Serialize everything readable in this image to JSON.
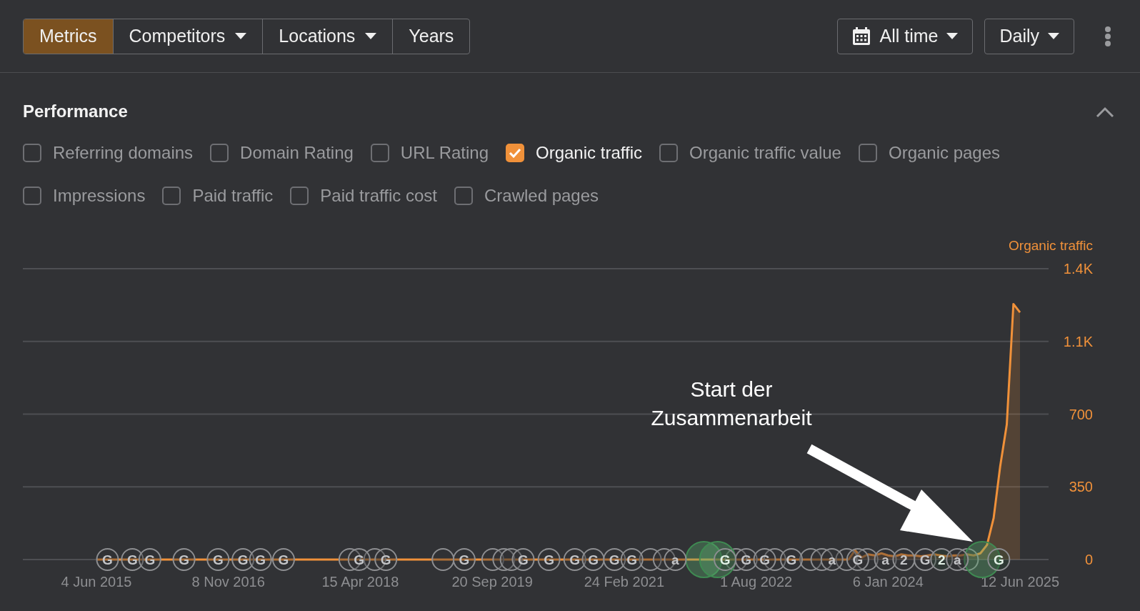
{
  "toolbar": {
    "segments": [
      {
        "label": "Metrics",
        "selected": true,
        "dropdown": false
      },
      {
        "label": "Competitors",
        "selected": false,
        "dropdown": true
      },
      {
        "label": "Locations",
        "selected": false,
        "dropdown": true
      },
      {
        "label": "Years",
        "selected": false,
        "dropdown": false
      }
    ],
    "date_range": {
      "label": "All time"
    },
    "interval": {
      "label": "Daily"
    }
  },
  "performance": {
    "title": "Performance",
    "expanded": true,
    "metrics": [
      {
        "label": "Referring domains",
        "checked": false
      },
      {
        "label": "Domain Rating",
        "checked": false
      },
      {
        "label": "URL Rating",
        "checked": false
      },
      {
        "label": "Organic traffic",
        "checked": true
      },
      {
        "label": "Organic traffic value",
        "checked": false
      },
      {
        "label": "Organic pages",
        "checked": false
      },
      {
        "label": "Impressions",
        "checked": false
      },
      {
        "label": "Paid traffic",
        "checked": false
      },
      {
        "label": "Paid traffic cost",
        "checked": false
      },
      {
        "label": "Crawled pages",
        "checked": false
      }
    ],
    "chart_data": {
      "type": "area",
      "grid": true,
      "categories": [
        "4 Jun 2015",
        null,
        null,
        null,
        null,
        null,
        null,
        null,
        null,
        null,
        null,
        null,
        null,
        null,
        null,
        null,
        null,
        null,
        null,
        null,
        "8 Nov 2016",
        null,
        null,
        null,
        null,
        null,
        null,
        null,
        null,
        null,
        null,
        null,
        null,
        null,
        null,
        null,
        null,
        null,
        null,
        null,
        "15 Apr 2018",
        null,
        null,
        null,
        null,
        null,
        null,
        null,
        null,
        null,
        null,
        null,
        null,
        null,
        null,
        null,
        null,
        null,
        null,
        null,
        "20 Sep 2019",
        null,
        null,
        null,
        null,
        null,
        null,
        null,
        null,
        null,
        null,
        null,
        null,
        null,
        null,
        null,
        null,
        null,
        null,
        null,
        "24 Feb 2021",
        null,
        null,
        null,
        null,
        null,
        null,
        null,
        null,
        null,
        null,
        null,
        null,
        null,
        null,
        null,
        null,
        null,
        null,
        null,
        "1 Aug 2022",
        null,
        null,
        null,
        null,
        null,
        null,
        null,
        null,
        null,
        null,
        null,
        null,
        null,
        null,
        null,
        null,
        null,
        null,
        null,
        "6 Jan 2024",
        null,
        null,
        null,
        null,
        null,
        null,
        null,
        null,
        null,
        null,
        null,
        null,
        null,
        null,
        null,
        null,
        null,
        null,
        null,
        "12 Jun 2025"
      ],
      "series": [
        {
          "name": "Organic traffic",
          "color": "#f0913a",
          "values": [
            0,
            0,
            0,
            0,
            0,
            0,
            0,
            0,
            0,
            0,
            0,
            0,
            0,
            0,
            0,
            0,
            0,
            0,
            0,
            0,
            0,
            0,
            0,
            0,
            0,
            0,
            0,
            0,
            0,
            0,
            0,
            0,
            0,
            0,
            0,
            0,
            0,
            0,
            0,
            0,
            0,
            0,
            0,
            0,
            0,
            0,
            0,
            0,
            0,
            0,
            0,
            0,
            0,
            0,
            0,
            0,
            0,
            0,
            0,
            0,
            0,
            0,
            0,
            0,
            0,
            0,
            0,
            0,
            0,
            0,
            0,
            0,
            0,
            0,
            0,
            0,
            0,
            0,
            0,
            0,
            0,
            0,
            0,
            0,
            0,
            0,
            0,
            0,
            0,
            0,
            0,
            0,
            0,
            0,
            0,
            0,
            0,
            0,
            0,
            0,
            0,
            0,
            0,
            0,
            0,
            0,
            0,
            0,
            0,
            0,
            0,
            0,
            0,
            0,
            0,
            45,
            10,
            25,
            20,
            30,
            20,
            15,
            25,
            20,
            20,
            15,
            20,
            25,
            20,
            15,
            20,
            20,
            25,
            20,
            30,
            70,
            200,
            450,
            650,
            1230,
            1190
          ]
        }
      ],
      "ylim": [
        0,
        1400
      ],
      "yticks": [
        {
          "value": 0,
          "label": "0"
        },
        {
          "value": 350,
          "label": "350"
        },
        {
          "value": 700,
          "label": "700"
        },
        {
          "value": 1050,
          "label": "1.1K"
        },
        {
          "value": 1400,
          "label": "1.4K"
        }
      ]
    },
    "update_markers": [
      {
        "label": "G",
        "kind": "normal"
      },
      {
        "label": "G",
        "kind": "normal"
      },
      {
        "label": "G",
        "kind": "normal"
      },
      {
        "label": "G",
        "kind": "normal"
      },
      {
        "label": "G",
        "kind": "normal"
      },
      {
        "label": "G",
        "kind": "normal"
      },
      {
        "label": "G",
        "kind": "normal"
      },
      {
        "label": "G",
        "kind": "normal"
      },
      {
        "kind": "normal"
      },
      {
        "label": "G",
        "kind": "normal"
      },
      {
        "kind": "normal"
      },
      {
        "label": "G",
        "kind": "normal"
      },
      {
        "kind": "normal"
      },
      {
        "label": "G",
        "kind": "normal"
      },
      {
        "kind": "normal"
      },
      {
        "kind": "normal"
      },
      {
        "kind": "normal"
      },
      {
        "label": "G",
        "kind": "normal"
      },
      {
        "label": "G",
        "kind": "normal"
      },
      {
        "label": "G",
        "kind": "normal"
      },
      {
        "label": "G",
        "kind": "normal"
      },
      {
        "label": "G",
        "kind": "normal"
      },
      {
        "label": "G",
        "kind": "normal"
      },
      {
        "kind": "normal"
      },
      {
        "kind": "normal"
      },
      {
        "label": "a",
        "kind": "normal"
      },
      {
        "kind": "highlight"
      },
      {
        "kind": "highlight"
      },
      {
        "label": "G",
        "kind": "dark"
      },
      {
        "kind": "normal"
      },
      {
        "label": "G",
        "kind": "normal"
      },
      {
        "label": "G",
        "kind": "normal"
      },
      {
        "kind": "normal"
      },
      {
        "label": "G",
        "kind": "normal"
      },
      {
        "kind": "normal"
      },
      {
        "kind": "normal"
      },
      {
        "label": "a",
        "kind": "normal"
      },
      {
        "kind": "normal"
      },
      {
        "label": "G",
        "kind": "normal"
      },
      {
        "kind": "normal"
      },
      {
        "label": "a",
        "kind": "normal"
      },
      {
        "label": "2",
        "kind": "normal"
      },
      {
        "label": "G",
        "kind": "normal"
      },
      {
        "label": "2",
        "kind": "dark"
      },
      {
        "label": "a",
        "kind": "normal"
      },
      {
        "kind": "normal"
      },
      {
        "kind": "highlight"
      },
      {
        "label": "G",
        "kind": "dark"
      }
    ],
    "callout": {
      "lines": [
        "Start der",
        "Zusammenarbeit"
      ]
    }
  }
}
